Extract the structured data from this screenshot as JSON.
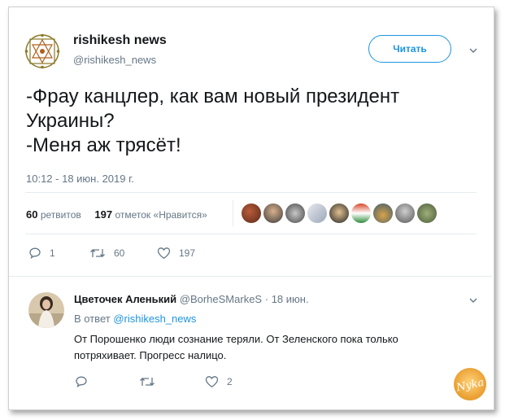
{
  "tweet": {
    "author_name": "rishikesh news",
    "author_handle": "@rishikesh_news",
    "follow_label": "Читать",
    "text": "-Фрау канцлер, как вам новый президент\nУкраины?\n-Меня аж трясёт!",
    "timestamp": "10:12 - 18 июн. 2019 г.",
    "retweets_count": "60",
    "retweets_label": "ретвитов",
    "likes_count": "197",
    "likes_label": "отметок «Нравится»",
    "actions": {
      "reply_count": "1",
      "retweet_count": "60",
      "like_count": "197"
    }
  },
  "reply": {
    "author_name": "Цветочек Аленький",
    "author_handle": "@BorheSMarkeS",
    "separator": "·",
    "date": "18 июн.",
    "in_reply_prefix": "В ответ",
    "in_reply_handle": "@rishikesh_news",
    "text": "От Порошенко люди сознание теряли. От Зеленского пока только\nпотряхивает. Прогресс налицо.",
    "like_count": "2"
  },
  "watermark": "Nyka",
  "colors": {
    "accent": "#1b95e0",
    "muted": "#657786",
    "text": "#14171a",
    "divider": "#e6ecf0"
  },
  "icons": [
    "mandala-logo",
    "chevron-down-icon",
    "reply-icon",
    "retweet-icon",
    "heart-icon"
  ]
}
